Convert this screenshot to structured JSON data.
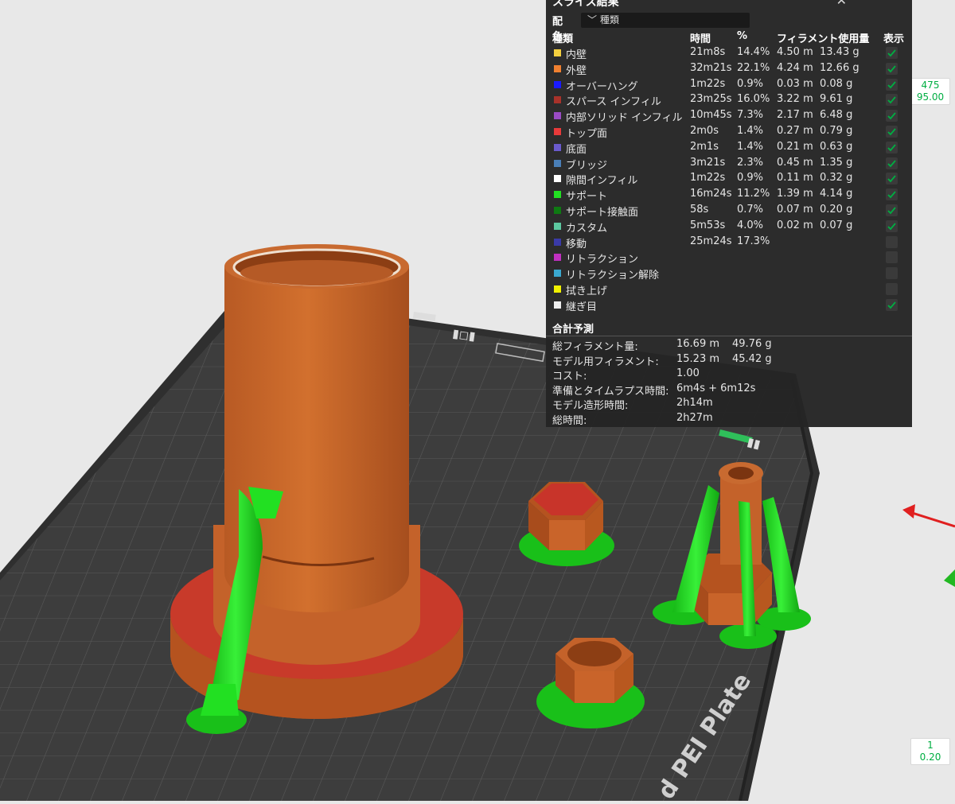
{
  "panel": {
    "title": "スライス結果",
    "color_label": "配色",
    "color_scheme": "種類",
    "headers": {
      "type": "種類",
      "time": "時間",
      "pct": "%",
      "filament": "フィラメント使用量",
      "show": "表示"
    },
    "rows": [
      {
        "name": "内壁",
        "time": "21m8s",
        "pct": "14.4%",
        "len": "4.50 m",
        "wt": "13.43 g",
        "color": "#f4d03f",
        "shown": true
      },
      {
        "name": "外壁",
        "time": "32m21s",
        "pct": "22.1%",
        "len": "4.24 m",
        "wt": "12.66 g",
        "color": "#f08030",
        "shown": true
      },
      {
        "name": "オーバーハング",
        "time": "1m22s",
        "pct": "0.9%",
        "len": "0.03 m",
        "wt": "0.08 g",
        "color": "#1a1aff",
        "shown": true
      },
      {
        "name": "スパース インフィル",
        "time": "23m25s",
        "pct": "16.0%",
        "len": "3.22 m",
        "wt": "9.61 g",
        "color": "#a8322a",
        "shown": true
      },
      {
        "name": "内部ソリッド インフィル",
        "time": "10m45s",
        "pct": "7.3%",
        "len": "2.17 m",
        "wt": "6.48 g",
        "color": "#9a4bc4",
        "shown": true
      },
      {
        "name": "トップ面",
        "time": "2m0s",
        "pct": "1.4%",
        "len": "0.27 m",
        "wt": "0.79 g",
        "color": "#e83a3a",
        "shown": true
      },
      {
        "name": "底面",
        "time": "2m1s",
        "pct": "1.4%",
        "len": "0.21 m",
        "wt": "0.63 g",
        "color": "#6a5acd",
        "shown": true
      },
      {
        "name": "ブリッジ",
        "time": "3m21s",
        "pct": "2.3%",
        "len": "0.45 m",
        "wt": "1.35 g",
        "color": "#4a7fb8",
        "shown": true
      },
      {
        "name": "隙間インフィル",
        "time": "1m22s",
        "pct": "0.9%",
        "len": "0.11 m",
        "wt": "0.32 g",
        "color": "#ffffff",
        "shown": true
      },
      {
        "name": "サポート",
        "time": "16m24s",
        "pct": "11.2%",
        "len": "1.39 m",
        "wt": "4.14 g",
        "color": "#22e022",
        "shown": true
      },
      {
        "name": "サポート接触面",
        "time": "58s",
        "pct": "0.7%",
        "len": "0.07 m",
        "wt": "0.20 g",
        "color": "#0e7a12",
        "shown": true
      },
      {
        "name": "カスタム",
        "time": "5m53s",
        "pct": "4.0%",
        "len": "0.02 m",
        "wt": "0.07 g",
        "color": "#5cc8a0",
        "shown": true
      },
      {
        "name": "移動",
        "time": "25m24s",
        "pct": "17.3%",
        "len": "",
        "wt": "",
        "color": "#3a3aa8",
        "shown": false
      },
      {
        "name": "リトラクション",
        "time": "",
        "pct": "",
        "len": "",
        "wt": "",
        "color": "#c030c0",
        "shown": false
      },
      {
        "name": "リトラクション解除",
        "time": "",
        "pct": "",
        "len": "",
        "wt": "",
        "color": "#3aa8d0",
        "shown": false
      },
      {
        "name": "拭き上げ",
        "time": "",
        "pct": "",
        "len": "",
        "wt": "",
        "color": "#f0f000",
        "shown": false
      },
      {
        "name": "継ぎ目",
        "time": "",
        "pct": "",
        "len": "",
        "wt": "",
        "color": "#eeeeee",
        "shown": true
      }
    ],
    "total_section": "合計予測",
    "totals": [
      {
        "label": "総フィラメント量:",
        "v1": "16.69 m",
        "v2": "49.76 g"
      },
      {
        "label": "モデル用フィラメント:",
        "v1": "15.23 m",
        "v2": "45.42 g"
      },
      {
        "label": "コスト:",
        "v1": "1.00",
        "v2": ""
      },
      {
        "label": "準備とタイムラプス時間:",
        "v1": "6m4s + 6m12s",
        "v2": ""
      },
      {
        "label": "モデル造形時間:",
        "v1": "2h14m",
        "v2": ""
      },
      {
        "label": "総時間:",
        "v1": "2h27m",
        "v2": ""
      }
    ]
  },
  "layer_slider": {
    "top_layer": "475",
    "top_height": "95.00",
    "bottom_layer": "1",
    "bottom_height": "0.20"
  },
  "plate": {
    "label": "d PEI Plate"
  },
  "colors": {
    "accent": "#00ae42",
    "bed": "#3c3c3c",
    "wall": "#c8642a",
    "support": "#22e022",
    "infill": "#c83a2a"
  }
}
